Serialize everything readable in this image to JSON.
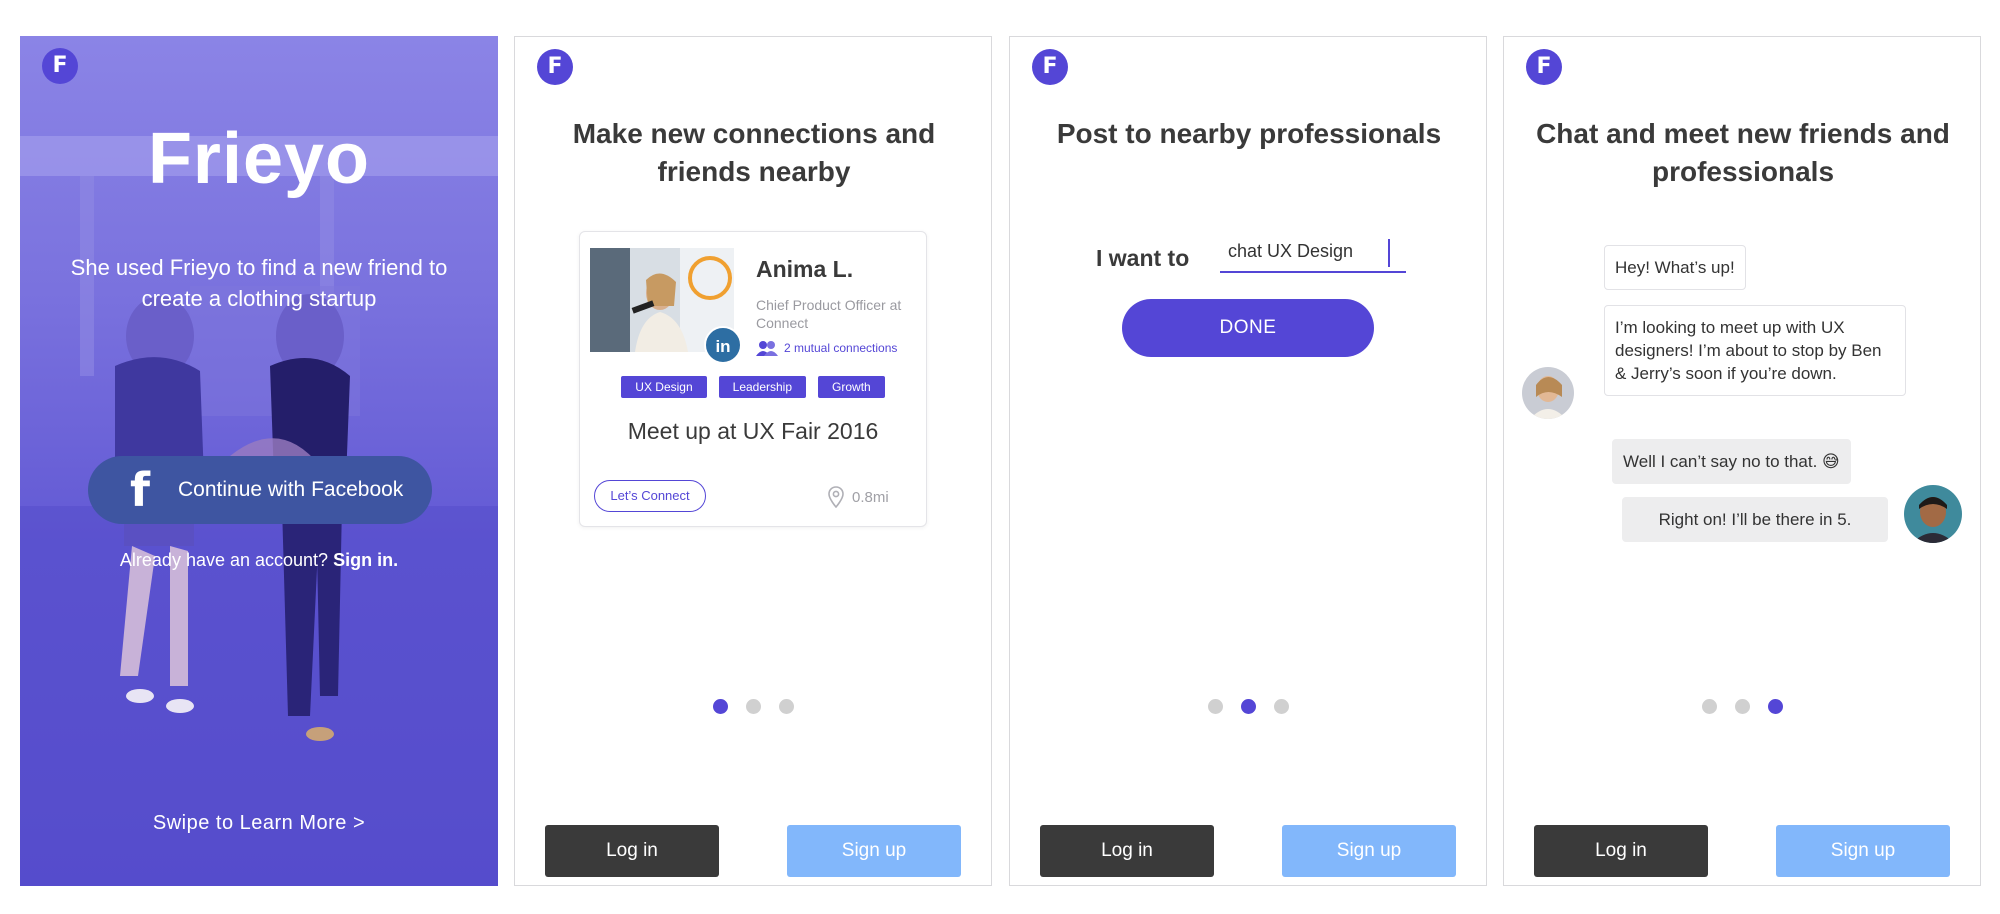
{
  "brand": {
    "logo_letter": "F",
    "accent": "#5446d6"
  },
  "screen1": {
    "title": "Frieyo",
    "subtitle": "She used Frieyo to find a new friend to create a clothing startup",
    "facebook_button": "Continue with Facebook",
    "account_prompt": "Already have an account?",
    "signin_link": "Sign in.",
    "swipe_text": "Swipe to Learn More  >"
  },
  "screen2": {
    "title": "Make new connections and friends nearby",
    "card": {
      "linkedin_badge": "in",
      "name": "Anima L.",
      "role": "Chief Product Officer at Connect",
      "mutual": "2 mutual connections",
      "tags": [
        "UX Design",
        "Leadership",
        "Growth"
      ],
      "event": "Meet up at UX Fair 2016",
      "connect_button": "Let’s Connect",
      "distance": "0.8mi"
    },
    "active_dot": 0
  },
  "screen3": {
    "title": "Post to nearby professionals",
    "want_label": "I want to",
    "input_value": "chat UX Design",
    "done_button": "DONE",
    "active_dot": 1
  },
  "screen4": {
    "title": "Chat and meet new friends and professionals",
    "messages": [
      {
        "text": "Hey! What’s up!"
      },
      {
        "text": "I’m looking to meet up with UX designers! I’m about to stop by Ben & Jerry’s soon if you’re down."
      },
      {
        "text": "Well I can’t say no to that. 😅"
      },
      {
        "text": "Right on! I’ll be there in 5."
      }
    ],
    "active_dot": 2
  },
  "footer": {
    "login_label": "Log in",
    "signup_label": "Sign up"
  }
}
